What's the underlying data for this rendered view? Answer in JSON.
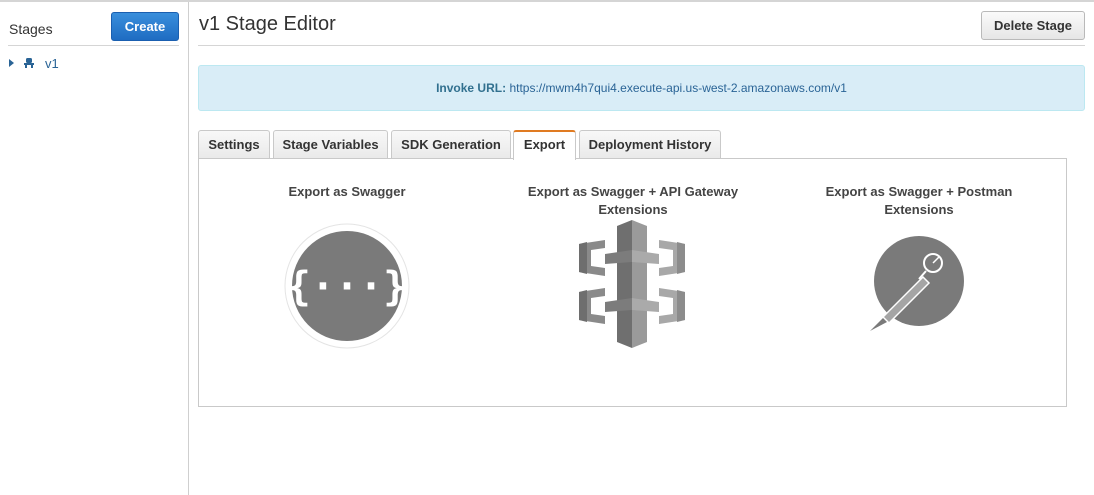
{
  "sidebar": {
    "title": "Stages",
    "create_label": "Create",
    "stage_items": [
      {
        "label": "v1",
        "icon": "stage-icon"
      }
    ]
  },
  "header": {
    "title": "v1 Stage Editor",
    "delete_label": "Delete Stage"
  },
  "invoke": {
    "label": "Invoke URL:",
    "url": "https://mwm4h7qui4.execute-api.us-west-2.amazonaws.com/v1"
  },
  "tabs": [
    {
      "label": "Settings",
      "active": false
    },
    {
      "label": "Stage Variables",
      "active": false
    },
    {
      "label": "SDK Generation",
      "active": false
    },
    {
      "label": "Export",
      "active": true
    },
    {
      "label": "Deployment History",
      "active": false
    }
  ],
  "export_options": [
    {
      "line1": "Export as Swagger",
      "line2": "",
      "icon": "swagger-icon"
    },
    {
      "line1": "Export as Swagger + API Gateway",
      "line2": "Extensions",
      "icon": "api-gateway-icon"
    },
    {
      "line1": "Export as Swagger + Postman",
      "line2": "Extensions",
      "icon": "postman-icon"
    }
  ],
  "colors": {
    "primary_button": "#1f6cc2",
    "link": "#2a6496",
    "info_bg": "#d9edf7",
    "active_tab_accent": "#e07b22",
    "icon_gray": "#7a7a7a"
  }
}
